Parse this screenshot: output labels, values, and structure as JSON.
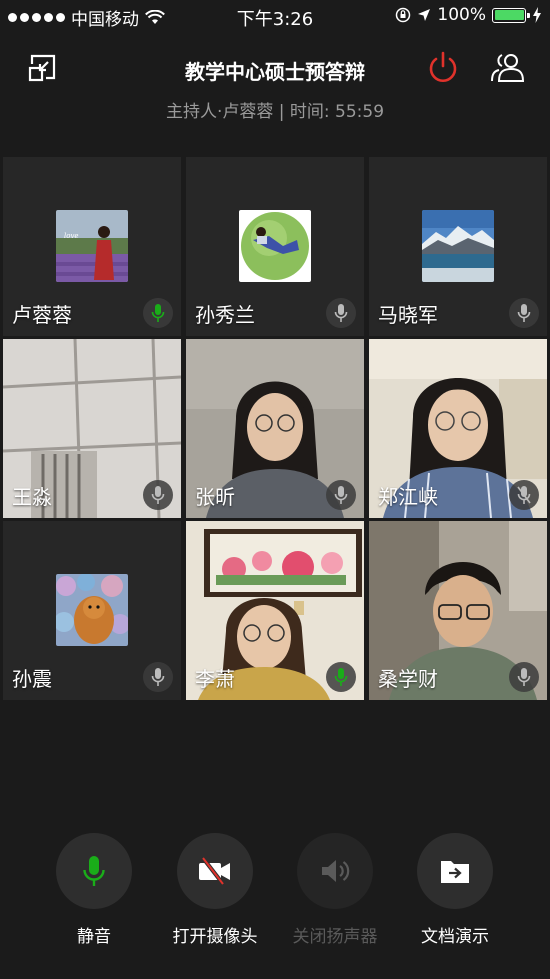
{
  "status_bar": {
    "carrier": "中国移动",
    "time": "下午3:26",
    "battery": "100%",
    "signal_icon": "signal-dots-icon",
    "wifi_icon": "wifi-icon"
  },
  "header": {
    "title": "教学中心硕士预答辩",
    "subtitle": "主持人·卢蓉蓉 | 时间: 55:59",
    "power_color": "#e0322b"
  },
  "participants": [
    {
      "name": "卢蓉蓉",
      "mic": "active"
    },
    {
      "name": "孙秀兰",
      "mic": "on"
    },
    {
      "name": "马晓军",
      "mic": "on"
    },
    {
      "name": "王淼",
      "mic": "on"
    },
    {
      "name": "张昕",
      "mic": "on"
    },
    {
      "name": "郑江峡",
      "mic": "muted"
    },
    {
      "name": "孙震",
      "mic": "on"
    },
    {
      "name": "李萧",
      "mic": "active"
    },
    {
      "name": "桑学财",
      "mic": "on"
    }
  ],
  "controls": {
    "mute": "静音",
    "camera": "打开摄像头",
    "speaker": "关闭扬声器",
    "share": "文档演示"
  },
  "colors": {
    "accent_green": "#1aad19",
    "background": "#1b1b1b",
    "tile_bg": "#272727"
  }
}
